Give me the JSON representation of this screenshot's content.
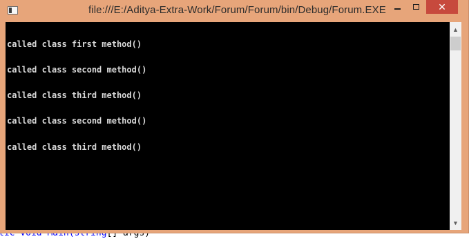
{
  "window": {
    "title": "file:///E:/Aditya-Extra-Work/Forum/Forum/bin/Debug/Forum.EXE",
    "frame_color": "#e7a57a",
    "close_color": "#c7493d",
    "minimize_icon": "minimize-icon",
    "maximize_icon": "maximize-icon",
    "close_icon": "close-icon",
    "close_glyph": "✕"
  },
  "console": {
    "background": "#000000",
    "text_color": "#d9d9d9",
    "lines": [
      "called class first method()",
      "called class second method()",
      "called class third method()",
      "called class second method()",
      "called class third method()"
    ]
  },
  "scrollbar": {
    "up_glyph": "▲",
    "down_glyph": "▼"
  },
  "background_editor": {
    "fragment_start": "tic void Main(",
    "fragment_kw": "string",
    "fragment_end": "[] args)"
  }
}
